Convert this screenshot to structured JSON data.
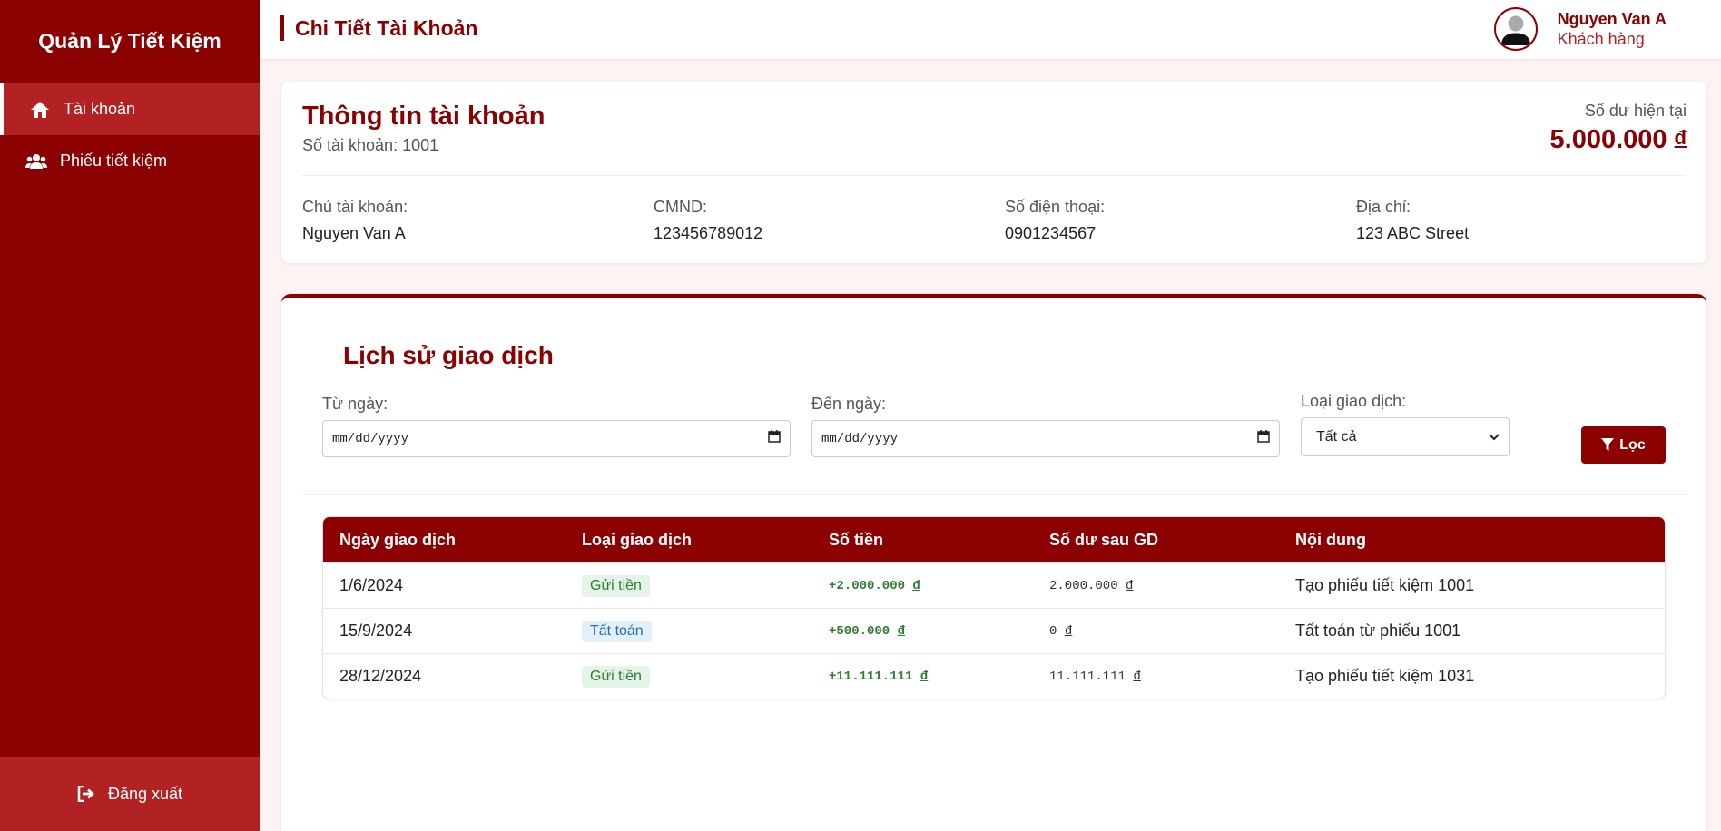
{
  "app": {
    "title": "Quản Lý Tiết Kiệm"
  },
  "sidebar": {
    "items": [
      {
        "label": "Tài khoản",
        "icon": "home-icon",
        "active": true
      },
      {
        "label": "Phiếu tiết kiệm",
        "icon": "users-icon",
        "active": false
      }
    ],
    "logout_label": "Đăng xuất"
  },
  "header": {
    "title": "Chi Tiết Tài Khoản",
    "user": {
      "name": "Nguyen Van A",
      "role": "Khách hàng"
    }
  },
  "account": {
    "heading": "Thông tin tài khoản",
    "number_label": "Số tài khoản: 1001",
    "balance_label": "Số dư hiện tại",
    "balance": "5.000.000",
    "currency": "đ",
    "fields": [
      {
        "label": "Chủ tài khoản:",
        "value": "Nguyen Van A"
      },
      {
        "label": "CMND:",
        "value": "123456789012"
      },
      {
        "label": "Số điện thoại:",
        "value": "0901234567"
      },
      {
        "label": "Địa chỉ:",
        "value": "123 ABC Street"
      }
    ]
  },
  "history": {
    "heading": "Lịch sử giao dịch",
    "filters": {
      "from_label": "Từ ngày:",
      "from_value": "mm/dd/yyyy",
      "to_label": "Đến ngày:",
      "to_value": "mm/dd/yyyy",
      "type_label": "Loại giao dịch:",
      "type_value": "Tất cả",
      "filter_button": "Lọc"
    },
    "columns": [
      "Ngày giao dịch",
      "Loại giao dịch",
      "Số tiền",
      "Số dư sau GD",
      "Nội dung"
    ],
    "rows": [
      {
        "date": "1/6/2024",
        "type": "Gửi tiền",
        "amount": "+2.000.000",
        "balance": "2.000.000",
        "note": "Tạo phiếu tiết kiệm 1001"
      },
      {
        "date": "15/9/2024",
        "type": "Tất toán",
        "amount": "+500.000",
        "balance": "0",
        "note": "Tất toán từ phiếu 1001"
      },
      {
        "date": "28/12/2024",
        "type": "Gửi tiền",
        "amount": "+11.111.111",
        "balance": "11.111.111",
        "note": "Tạo phiếu tiết kiệm 1031"
      }
    ],
    "currency": "đ"
  },
  "colors": {
    "primary": "#8b0000",
    "accent": "#b22222",
    "positive": "#2e7d32"
  }
}
